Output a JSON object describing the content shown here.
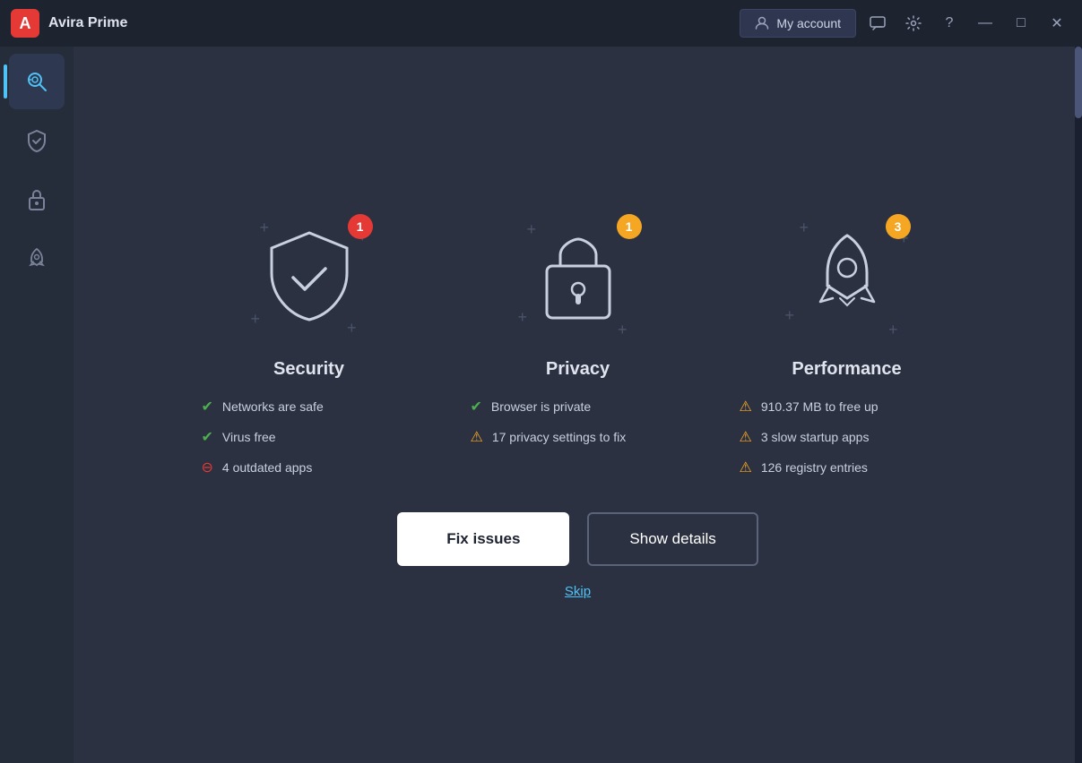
{
  "app": {
    "title": "Avira Prime",
    "logo_letter": "A"
  },
  "header": {
    "my_account_label": "My account",
    "message_icon": "💬",
    "settings_icon": "⚙",
    "help_icon": "?",
    "minimize_icon": "—",
    "maximize_icon": "□",
    "close_icon": "✕"
  },
  "sidebar": {
    "items": [
      {
        "name": "scan",
        "icon": "🔍",
        "active": true
      },
      {
        "name": "security",
        "icon": "🛡"
      },
      {
        "name": "privacy",
        "icon": "🔒"
      },
      {
        "name": "performance",
        "icon": "🚀"
      }
    ]
  },
  "cards": [
    {
      "id": "security",
      "title": "Security",
      "badge": "1",
      "badge_color": "red",
      "status_items": [
        {
          "icon": "check",
          "color": "green",
          "text": "Networks are safe"
        },
        {
          "icon": "check",
          "color": "green",
          "text": "Virus free"
        },
        {
          "icon": "minus",
          "color": "red",
          "text": "4 outdated apps"
        }
      ]
    },
    {
      "id": "privacy",
      "title": "Privacy",
      "badge": "1",
      "badge_color": "orange",
      "status_items": [
        {
          "icon": "check",
          "color": "green",
          "text": "Browser is private"
        },
        {
          "icon": "warning",
          "color": "orange",
          "text": "17 privacy settings to fix"
        }
      ]
    },
    {
      "id": "performance",
      "title": "Performance",
      "badge": "3",
      "badge_color": "orange",
      "status_items": [
        {
          "icon": "warning",
          "color": "orange",
          "text": "910.37 MB to free up"
        },
        {
          "icon": "warning",
          "color": "orange",
          "text": "3 slow startup apps"
        },
        {
          "icon": "warning",
          "color": "orange",
          "text": "126 registry entries"
        }
      ]
    }
  ],
  "buttons": {
    "fix_issues": "Fix issues",
    "show_details": "Show details"
  },
  "skip_label": "Skip"
}
